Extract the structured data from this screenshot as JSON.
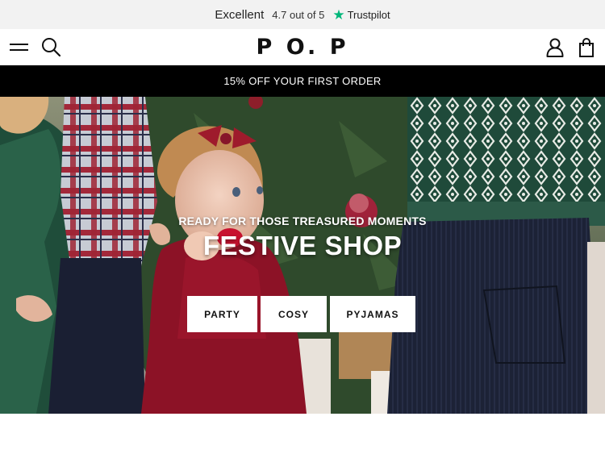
{
  "trustbar": {
    "headline": "Excellent",
    "rating_text": "4.7 out of 5",
    "brand": "Trustpilot",
    "star_icon": "trustpilot-star-icon",
    "star_color": "#00b67a"
  },
  "header": {
    "logo": "P O. P",
    "icons": [
      "menu-icon",
      "search-icon",
      "account-icon",
      "shopping-bag-icon"
    ]
  },
  "promo": {
    "text": "15% OFF YOUR FIRST ORDER",
    "background": "#000000"
  },
  "hero": {
    "eyebrow": "READY FOR THOSE TREASURED MOMENTS",
    "title": "FESTIVE SHOP",
    "buttons": [
      {
        "label": "PARTY"
      },
      {
        "label": "COSY"
      },
      {
        "label": "PYJAMAS"
      }
    ]
  }
}
